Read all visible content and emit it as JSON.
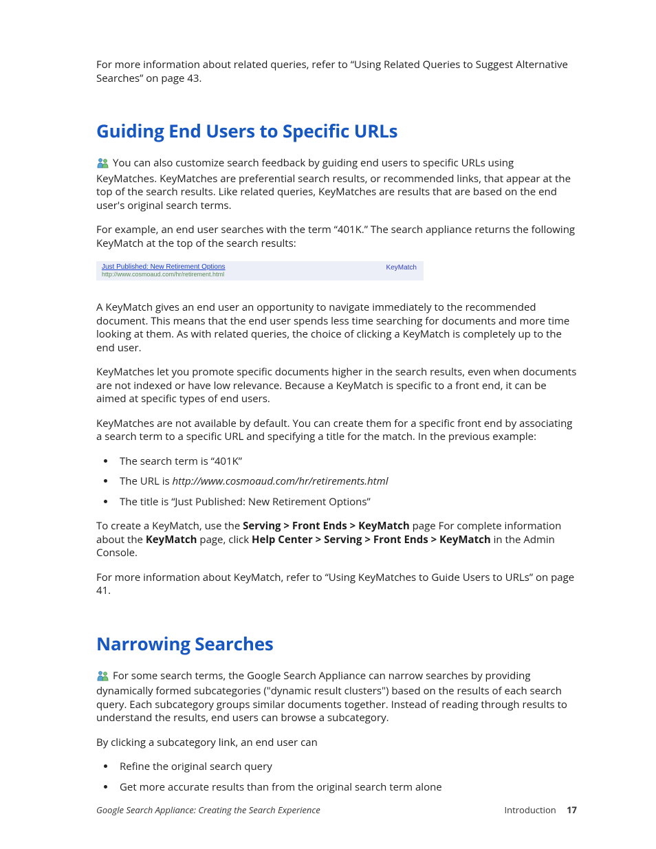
{
  "intro": {
    "p_top": "For more information about related queries, refer to “Using Related Queries to Suggest Alternative Searches” on page 43."
  },
  "section1": {
    "heading": "Guiding End Users to Specific URLs",
    "p1": "You can also customize search feedback by guiding end users to specific URLs using KeyMatches. KeyMatches are preferential search results, or recommended links, that appear at the top of the search results. Like related queries, KeyMatches are results that are based on the end user's original search terms.",
    "p2": "For example, an end user searches with the term “401K.” The search appliance returns the following KeyMatch at the top of the search results:",
    "keymatch": {
      "title": "Just Published: New Retirement Options",
      "url": "http://www.cosmoaud.com/hr/retirement.html",
      "label": "KeyMatch"
    },
    "p3": "A KeyMatch gives an end user an opportunity to navigate immediately to the recommended document. This means that the end user spends less time searching for documents and more time looking at them. As with related queries, the choice of clicking a KeyMatch is completely up to the end user.",
    "p4": "KeyMatches let you promote specific documents higher in the search results, even when documents are not indexed or have low relevance. Because a KeyMatch is specific to a front end, it can be aimed at specific types of end users.",
    "p5": "KeyMatches are not available by default. You can create them for a specific front end by associating a search term to a specific URL and specifying a title for the match. In the previous example:",
    "bullets1": {
      "b1": "The search term is “401K”",
      "b2_pre": "The URL is ",
      "b2_url": "http://www.cosmoaud.com/hr/retirements.html",
      "b3": "The title is “Just Published: New Retirement Options”"
    },
    "p6": {
      "t1": "To create a KeyMatch, use the ",
      "b1": "Serving > Front Ends > KeyMatch",
      "t2": " page For complete information about the ",
      "b2": "KeyMatch",
      "t3": " page, click ",
      "b3": "Help Center > Serving > Front Ends > KeyMatch",
      "t4": " in the Admin Console."
    },
    "p7": "For more information about KeyMatch, refer to “Using KeyMatches to Guide Users to URLs” on page 41."
  },
  "section2": {
    "heading": "Narrowing Searches",
    "p1": "For some search terms, the Google Search Appliance can narrow searches by providing dynamically formed subcategories (\"dynamic result clusters\") based on the results of each search query. Each subcategory groups similar documents together. Instead of reading through results to understand the results, end users can browse a subcategory.",
    "p2": "By clicking a subcategory link, an end user can",
    "bullets": {
      "b1": "Refine the original search query",
      "b2": "Get more accurate results than from the original search term alone"
    }
  },
  "footer": {
    "left": "Google Search Appliance: Creating the Search Experience",
    "right_label": "Introduction",
    "page_num": "17"
  }
}
